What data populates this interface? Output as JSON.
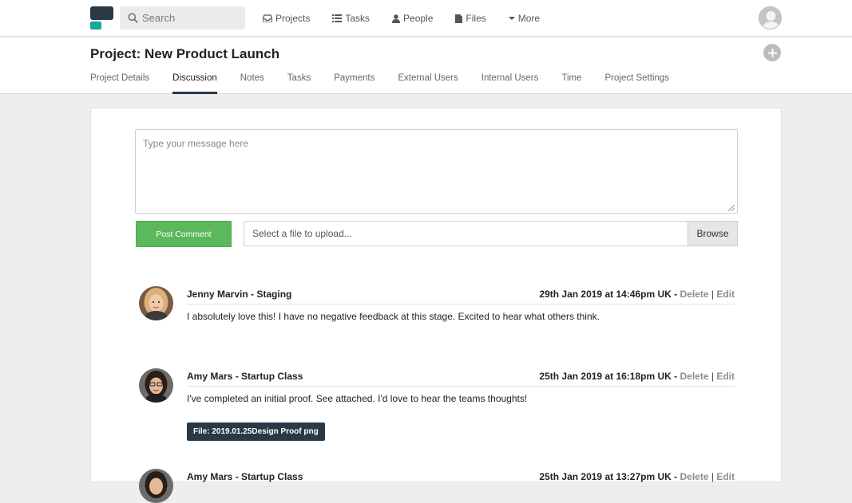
{
  "topbar": {
    "search_placeholder": "Search",
    "nav": [
      {
        "label": "Projects",
        "icon": "inbox-icon"
      },
      {
        "label": "Tasks",
        "icon": "list-icon"
      },
      {
        "label": "People",
        "icon": "person-icon"
      },
      {
        "label": "Files",
        "icon": "file-icon"
      },
      {
        "label": "More",
        "icon": "caret-down-icon"
      }
    ]
  },
  "project": {
    "title": "Project: New Product Launch",
    "tabs": [
      "Project Details",
      "Discussion",
      "Notes",
      "Tasks",
      "Payments",
      "External Users",
      "Internal Users",
      "Time",
      "Project Settings"
    ],
    "active_tab": "Discussion"
  },
  "composer": {
    "message_placeholder": "Type your message here",
    "post_label": "Post Comment",
    "file_placeholder": "Select a file to upload...",
    "browse_label": "Browse"
  },
  "comments": [
    {
      "author": "Jenny Marvin - Staging",
      "timestamp": "29th Jan 2019 at 14:46pm UK",
      "text": "I absolutely love this! I have no negative feedback at this stage. Excited to hear what others think.",
      "delete_label": "Delete",
      "edit_label": "Edit"
    },
    {
      "author": "Amy Mars - Startup Class",
      "timestamp": "25th Jan 2019 at 16:18pm UK",
      "text": "I've completed an initial proof. See attached. I'd love to hear the teams thoughts!",
      "file": "File: 2019.01.25Design Proof png",
      "delete_label": "Delete",
      "edit_label": "Edit"
    },
    {
      "author": "Amy Mars - Startup Class",
      "timestamp": "25th Jan 2019 at 13:27pm UK",
      "delete_label": "Delete",
      "edit_label": "Edit"
    }
  ],
  "colors": {
    "primary_dark": "#2b3945",
    "teal": "#17a79b",
    "success": "#5cb85c"
  }
}
